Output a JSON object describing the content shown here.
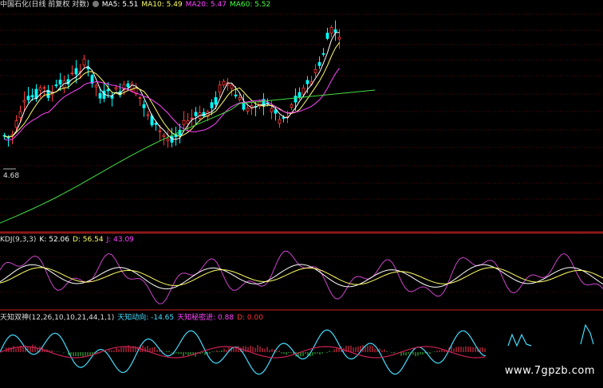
{
  "main": {
    "title": "中国石化(日线 前复权 对数)",
    "indicators": [
      {
        "label": "MA5: 5.51",
        "color": "#ffffff"
      },
      {
        "label": "MA10: 5.49",
        "color": "#ffff66"
      },
      {
        "label": "MA20: 5.47",
        "color": "#ff44ff"
      },
      {
        "label": "MA60: 5.52",
        "color": "#44ff44"
      }
    ],
    "low_label": "4.68"
  },
  "kdj": {
    "title": "KDJ(9,3,3)",
    "indicators": [
      {
        "label": "K: 52.06",
        "color": "#ffffff"
      },
      {
        "label": "D: 56.54",
        "color": "#ffff66"
      },
      {
        "label": "J: 43.09",
        "color": "#ff44ff"
      }
    ],
    "markers": [
      "$",
      "$"
    ]
  },
  "tz": {
    "title": "天知双神(12,26,10,10,21,44,1,1)",
    "indicators": [
      {
        "label": "天知动向: -14.65",
        "color": "#44ddff"
      },
      {
        "label": "天知秘密进: 0.88",
        "color": "#ff44ff"
      },
      {
        "label": "D: 0.00",
        "color": "#ff3333"
      }
    ]
  },
  "watermark": "www.7gpzb.com",
  "colors": {
    "up": "#ff3a3a",
    "down": "#00ffff",
    "grid": "#a01010",
    "separator": "#cc2222",
    "ma5": "#ffffff",
    "ma10": "#ffff66",
    "ma20": "#ff44ff",
    "ma60": "#44dd44",
    "kdj_k": "#ffffff",
    "kdj_d": "#ffff66",
    "kdj_j": "#cc44cc",
    "tz_line": "#44ddff",
    "tz_red": "#ff3355",
    "tz_green": "#44cc44"
  }
}
